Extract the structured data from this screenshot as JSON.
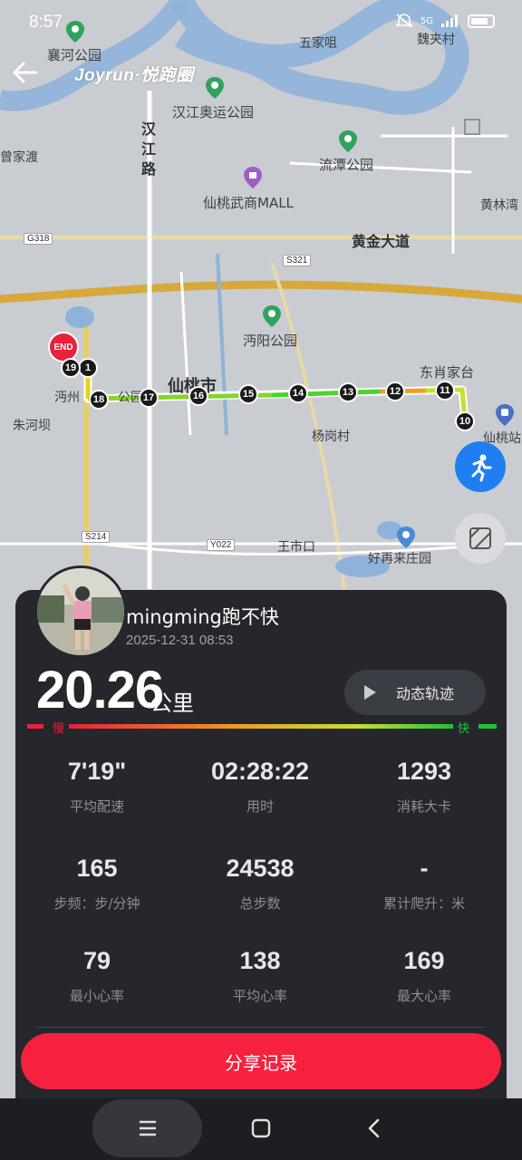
{
  "status_bar": {
    "time": "8:57",
    "network": "5G"
  },
  "header": {
    "brand": "Joyrun·悦跑圈"
  },
  "map": {
    "labels": {
      "xiangheyuan": "襄河公园",
      "wujiazui": "五家咀",
      "weijiacun": "魏夹村",
      "hanjiang_olympic": "汉江奥运公园",
      "jiadu": "曾家渡",
      "hanjiang_road": "汉江路",
      "liutan": "流潭公园",
      "wushang": "仙桃武商MALL",
      "huanglin": "黄林湾",
      "huangjin": "黄金大道",
      "mianyang": "沔阳公园",
      "xiantao": "仙桃市",
      "dongxiao": "东肖家台",
      "mianzhou": "沔州",
      "zhuhe": "朱河坝",
      "yanggang": "杨岗村",
      "xiantao_station": "仙桃站",
      "wangshikou": "王市口",
      "haozailai": "好再来庄园",
      "mian_park_fragment": "公园",
      "end_marker": "END"
    },
    "roads": {
      "g318": "G318",
      "s321": "S321",
      "s214": "S214",
      "y022": "Y022"
    },
    "route_nodes": [
      "1",
      "10",
      "11",
      "12",
      "13",
      "14",
      "15",
      "16",
      "17",
      "18",
      "19"
    ]
  },
  "record": {
    "username": "mingming跑不快",
    "datetime": "2025-12-31 08:53",
    "distance": "20.26",
    "distance_unit": "公里",
    "dynamic_track_label": "动态轨迹",
    "speed_slow": "慢",
    "speed_fast": "快",
    "stats": [
      {
        "value": "7'19\"",
        "label": "平均配速"
      },
      {
        "value": "02:28:22",
        "label": "用时"
      },
      {
        "value": "1293",
        "label": "消耗大卡"
      },
      {
        "value": "165",
        "label": "步频：步/分钟"
      },
      {
        "value": "24538",
        "label": "总步数"
      },
      {
        "value": "-",
        "label": "累计爬升：米"
      },
      {
        "value": "79",
        "label": "最小心率"
      },
      {
        "value": "138",
        "label": "平均心率"
      },
      {
        "value": "169",
        "label": "最大心率"
      }
    ],
    "share_label": "分享记录"
  },
  "colors": {
    "accent": "#f5213f",
    "card_bg": "#25272c",
    "route_fast": "#21c13a",
    "route_slow": "#e8213c"
  }
}
